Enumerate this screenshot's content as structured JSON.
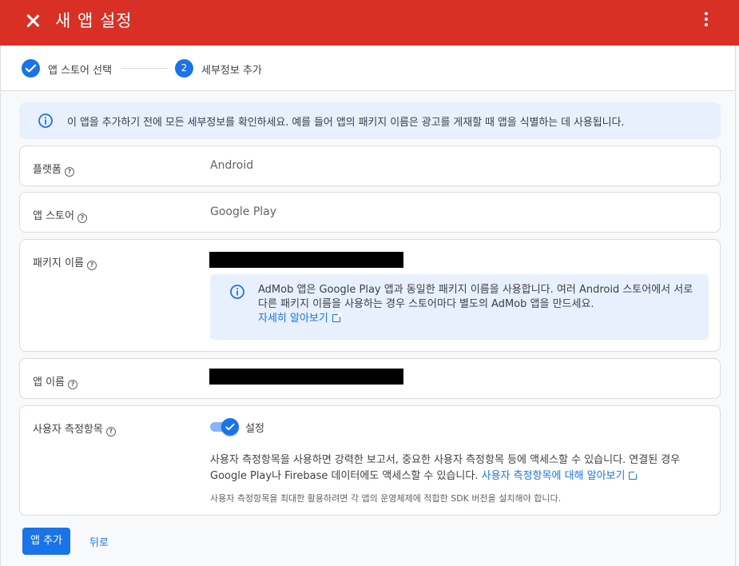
{
  "header": {
    "title": "새 앱 설정"
  },
  "stepper": {
    "step1_label": "앱 스토어 선택",
    "step2_number": "2",
    "step2_label": "세부정보 추가"
  },
  "info_banner": {
    "text": "이 앱을 추가하기 전에 모든 세부정보를 확인하세요. 예를 들어 앱의 패키지 이름은 광고를 게재할 때 앱을 식별하는 데 사용됩니다."
  },
  "fields": {
    "platform": {
      "label": "플랫폼",
      "value": "Android"
    },
    "app_store": {
      "label": "앱 스토어",
      "value": "Google Play"
    },
    "package_name": {
      "label": "패키지 이름",
      "note": "AdMob 앱은 Google Play 앱과 동일한 패키지 이름을 사용합니다. 여러 Android 스토어에서 서로 다른 패키지 이름을 사용하는 경우 스토어마다 별도의 AdMob 앱을 만드세요.",
      "learn_more": "자세히 알아보기"
    },
    "app_name": {
      "label": "앱 이름"
    },
    "user_metrics": {
      "label": "사용자 측정항목",
      "toggle_label": "설정",
      "toggle_on": true,
      "description": "사용자 측정항목을 사용하면 강력한 보고서, 중요한 사용자 측정항목 등에 액세스할 수 있습니다. 연결된 경우 Google Play나 Firebase 데이터에도 액세스할 수 있습니다.",
      "learn_more": "사용자 측정항목에 대해 알아보기",
      "note": "사용자 측정항목을 최대한 활용하려면 각 앱의 운영체제에 적합한 SDK 버전을 설치해야 합니다."
    }
  },
  "actions": {
    "add_app": "앱 추가",
    "back": "뒤로"
  },
  "colors": {
    "header_bg": "#d93025",
    "primary": "#1a73e8",
    "info_bg": "#e8f0fe"
  }
}
